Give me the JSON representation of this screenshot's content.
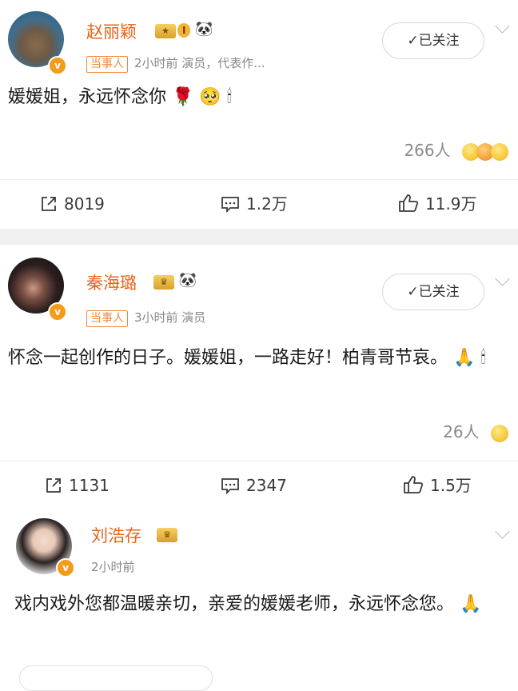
{
  "posts": [
    {
      "name": "赵丽颖",
      "level": "I",
      "tag": "当事人",
      "meta": "2小时前  演员，代表作...",
      "follow": "✓已关注",
      "text": "媛媛姐，永远怀念你",
      "likes": "266人",
      "repost": "8019",
      "comment": "1.2万",
      "like": "11.9万"
    },
    {
      "name": "秦海璐",
      "tag": "当事人",
      "meta": "3小时前  演员",
      "follow": "✓已关注",
      "text": "怀念一起创作的日子。媛媛姐，一路走好！柏青哥节哀。",
      "likes": "26人",
      "repost": "1131",
      "comment": "2347",
      "like": "1.5万"
    },
    {
      "name": "刘浩存",
      "meta": "2小时前",
      "text": "戏内戏外您都温暖亲切，亲爱的媛媛老师，永远怀念您。"
    }
  ],
  "icons": {
    "emoji_rose": "🌹",
    "emoji_pleading": "🥺",
    "emoji_candle": "🕯",
    "emoji_pray": "🙏",
    "emoji_panda": "🐼"
  },
  "colors": {
    "name": "#e8631a",
    "tag": "#f08a3e",
    "verified": "#f39b1a"
  }
}
